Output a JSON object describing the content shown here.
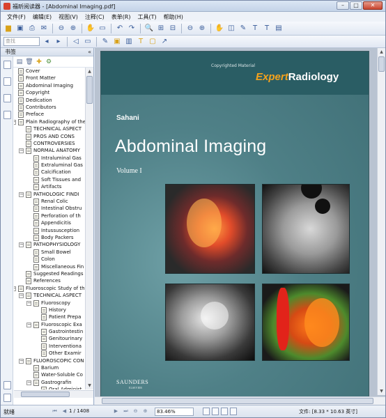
{
  "window": {
    "title": "福昕阅读器 - [Abdominal Imaging.pdf]",
    "controls": {
      "minimize": "–",
      "maximize": "□",
      "close": "✕"
    }
  },
  "menu": [
    "文件(F)",
    "编辑(E)",
    "视图(V)",
    "注释(C)",
    "表单(R)",
    "工具(T)",
    "帮助(H)"
  ],
  "toolbar2": {
    "search_placeholder": "查找"
  },
  "sidebar": {
    "header": "书签",
    "collapse": "«",
    "bookmarks": [
      {
        "label": "Cover",
        "level": 0
      },
      {
        "label": "Front Matter",
        "level": 0
      },
      {
        "label": "Abdominal Imaging",
        "level": 0
      },
      {
        "label": "Copyright",
        "level": 0
      },
      {
        "label": "Dedication",
        "level": 0
      },
      {
        "label": "Contributors",
        "level": 0
      },
      {
        "label": "Preface",
        "level": 0
      },
      {
        "label": "Plain Radiography of the",
        "level": 0,
        "expand": "−"
      },
      {
        "label": "TECHNICAL ASPECT",
        "level": 1
      },
      {
        "label": "PROS AND CONS",
        "level": 1
      },
      {
        "label": "CONTROVERSIES",
        "level": 1
      },
      {
        "label": "NORMAL ANATOMY",
        "level": 1,
        "expand": "−"
      },
      {
        "label": "Intraluminal Gas",
        "level": 2
      },
      {
        "label": "Extraluminal Gas",
        "level": 2
      },
      {
        "label": "Calcification",
        "level": 2
      },
      {
        "label": "Soft Tissues and",
        "level": 2
      },
      {
        "label": "Artifacts",
        "level": 2
      },
      {
        "label": "PATHOLOGIC FINDI",
        "level": 1,
        "expand": "−"
      },
      {
        "label": "Renal Colic",
        "level": 2
      },
      {
        "label": "Intestinal Obstru",
        "level": 2
      },
      {
        "label": "Perforation of th",
        "level": 2
      },
      {
        "label": "Appendicitis",
        "level": 2
      },
      {
        "label": "Intussusception",
        "level": 2
      },
      {
        "label": "Body Packers",
        "level": 2
      },
      {
        "label": "PATHOPHYSIOLOGY",
        "level": 1,
        "expand": "−"
      },
      {
        "label": "Small Bowel",
        "level": 2
      },
      {
        "label": "Colon",
        "level": 2
      },
      {
        "label": "Miscellaneous Fin",
        "level": 2
      },
      {
        "label": "Suggested Readings",
        "level": 1
      },
      {
        "label": "References",
        "level": 1
      },
      {
        "label": "Fluoroscopic Study of th",
        "level": 0,
        "expand": "−"
      },
      {
        "label": "TECHNICAL ASPECT",
        "level": 1,
        "expand": "−"
      },
      {
        "label": "Fluoroscopy",
        "level": 2,
        "expand": "−"
      },
      {
        "label": "History",
        "level": 3
      },
      {
        "label": "Patient Prepa",
        "level": 3
      },
      {
        "label": "Fluoroscopic Exa",
        "level": 2,
        "expand": "−"
      },
      {
        "label": "Gastrointestin",
        "level": 3
      },
      {
        "label": "Genitourinary",
        "level": 3
      },
      {
        "label": "Interventiona",
        "level": 3
      },
      {
        "label": "Other Examir",
        "level": 3
      },
      {
        "label": "FLUOROSCOPIC CON",
        "level": 1,
        "expand": "−"
      },
      {
        "label": "Barium",
        "level": 2
      },
      {
        "label": "Water-Soluble Co",
        "level": 2
      },
      {
        "label": "Gastrografin",
        "level": 2,
        "expand": "−"
      },
      {
        "label": "Oral Administ",
        "level": 3
      }
    ]
  },
  "document": {
    "copyright_notice": "Copyrighted Material",
    "series_brand_a": "Expert",
    "series_brand_b": "Radiology",
    "author": "Sahani",
    "title": "Abdominal Imaging",
    "volume": "Volume I",
    "publisher": "SAUNDERS",
    "publisher_sub": "ELSEVIER"
  },
  "statusbar": {
    "ready": "就绪",
    "page_indicator": "1 / 1408",
    "zoom": "83.46%",
    "file_size": "文件: [8.33 * 10.63 英寸]"
  }
}
